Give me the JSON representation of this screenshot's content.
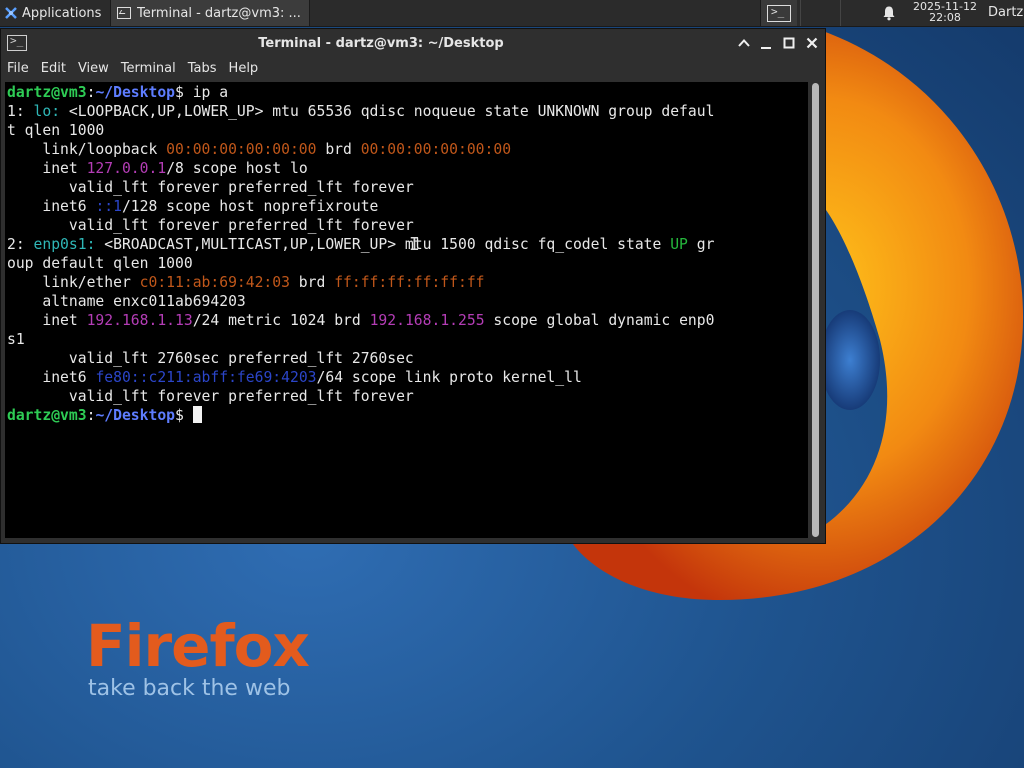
{
  "panel": {
    "applications_label": "Applications",
    "task_label": "Terminal - dartz@vm3: ...",
    "clock_date": "2025-11-12",
    "clock_time": "22:08",
    "user": "Dartz"
  },
  "window": {
    "title": "Terminal - dartz@vm3: ~/Desktop",
    "menu": [
      "File",
      "Edit",
      "View",
      "Terminal",
      "Tabs",
      "Help"
    ]
  },
  "terminal": {
    "user_host": "dartz@vm3",
    "path": "~/Desktop",
    "command": "ip a",
    "lines": {
      "l1_pre": "1: ",
      "l1_if": "lo:",
      "l1_rest": " <LOOPBACK,UP,LOWER_UP> mtu 65536 qdisc noqueue state UNKNOWN group defaul",
      "l2": "t qlen 1000",
      "l3_a": "    link/loopback ",
      "l3_mac": "00:00:00:00:00:00",
      "l3_b": " brd ",
      "l3_brd": "00:00:00:00:00:00",
      "l4_a": "    inet ",
      "l4_ip": "127.0.0.1",
      "l4_b": "/8 scope host lo",
      "l5": "       valid_lft forever preferred_lft forever",
      "l6_a": "    inet6 ",
      "l6_ip": "::1",
      "l6_b": "/128 scope host noprefixroute",
      "l7": "       valid_lft forever preferred_lft forever",
      "l8_pre": "2: ",
      "l8_if": "enp0s1:",
      "l8_rest": " <BROADCAST,MULTICAST,UP,LOWER_UP> mtu 1500 qdisc fq_codel state ",
      "l8_up": "UP",
      "l8_end": " gr",
      "l9": "oup default qlen 1000",
      "l10_a": "    link/ether ",
      "l10_mac": "c0:11:ab:69:42:03",
      "l10_b": " brd ",
      "l10_brd": "ff:ff:ff:ff:ff:ff",
      "l11": "    altname enxc011ab694203",
      "l12_a": "    inet ",
      "l12_ip": "192.168.1.13",
      "l12_b": "/24 metric 1024 brd ",
      "l12_brd": "192.168.1.255",
      "l12_c": " scope global dynamic enp0",
      "l13": "s1",
      "l14": "       valid_lft 2760sec preferred_lft 2760sec",
      "l15_a": "    inet6 ",
      "l15_ip": "fe80::c211:abff:fe69:4203",
      "l15_b": "/64 scope link proto kernel_ll",
      "l16": "       valid_lft forever preferred_lft forever"
    }
  },
  "wallpaper": {
    "brand": "Firefox",
    "tagline": "take back the web"
  },
  "colors": {
    "prompt_user": "#2ecc55",
    "prompt_path": "#5e7dff",
    "mac": "#c0571a",
    "ipv4": "#b43db6",
    "ipv6": "#2b45c8",
    "state_up": "#25b83c"
  }
}
